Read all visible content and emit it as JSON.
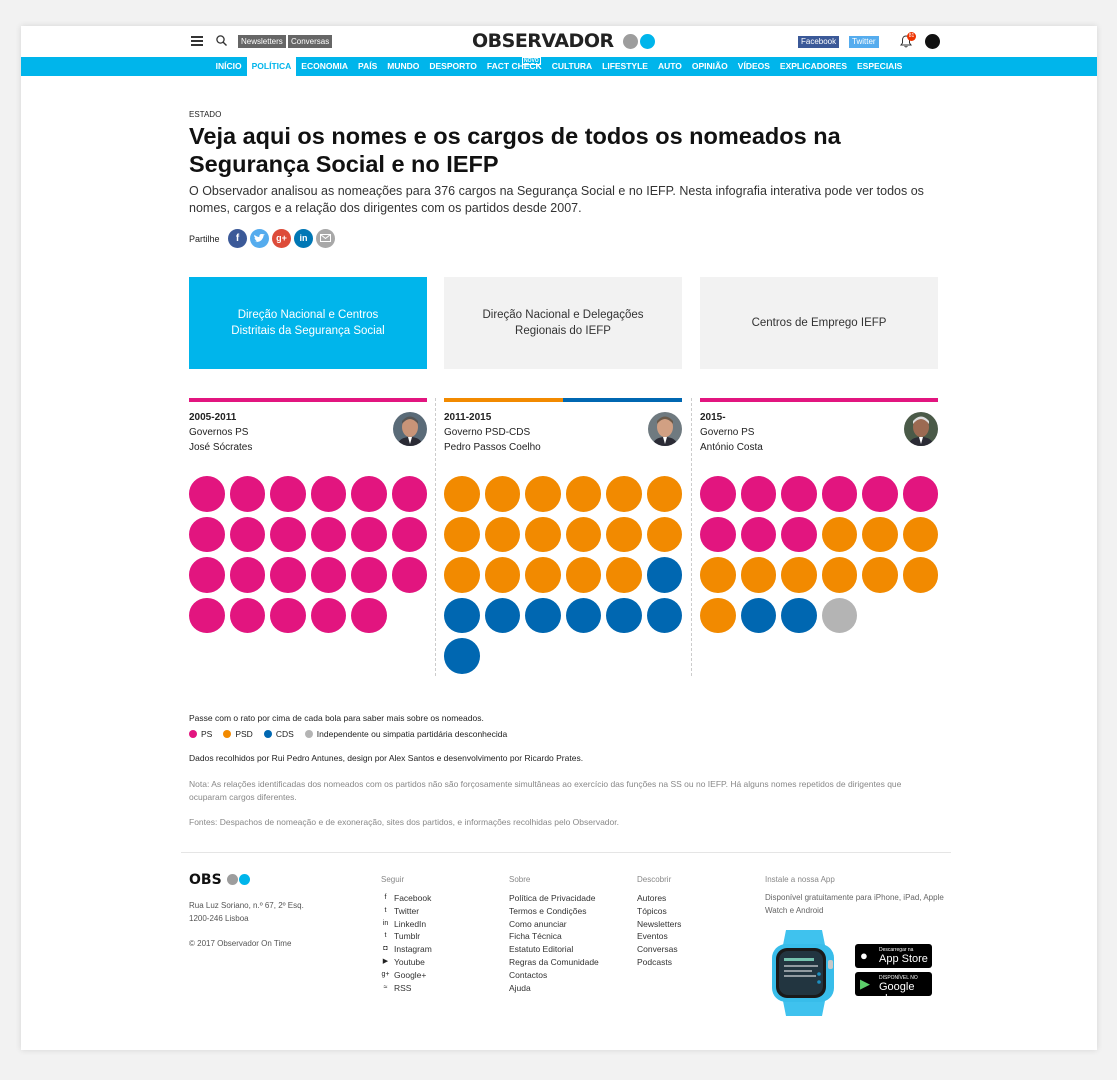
{
  "header": {
    "newsletters": "Newsletters",
    "conversas": "Conversas",
    "logo": "OBSERVADOR",
    "facebook": "Facebook",
    "twitter": "Twitter",
    "notifications": "81"
  },
  "nav": [
    {
      "label": "INÍCIO",
      "active": false
    },
    {
      "label": "POLÍTICA",
      "active": true
    },
    {
      "label": "ECONOMIA",
      "active": false
    },
    {
      "label": "PAÍS",
      "active": false
    },
    {
      "label": "MUNDO",
      "active": false
    },
    {
      "label": "DESPORTO",
      "active": false
    },
    {
      "label": "FACT CHECK",
      "active": false,
      "tag": "NOVO"
    },
    {
      "label": "CULTURA",
      "active": false
    },
    {
      "label": "LIFESTYLE",
      "active": false
    },
    {
      "label": "AUTO",
      "active": false
    },
    {
      "label": "OPINIÃO",
      "active": false
    },
    {
      "label": "VÍDEOS",
      "active": false
    },
    {
      "label": "EXPLICADORES",
      "active": false
    },
    {
      "label": "ESPECIAIS",
      "active": false
    }
  ],
  "article": {
    "kicker": "ESTADO",
    "title": "Veja aqui os nomes e os cargos de todos os nomeados na Segurança Social e no IEFP",
    "lede": "O Observador analisou as nomeações para 376 cargos na Segurança Social e no IEFP. Nesta infografia interativa pode ver todos os nomes, cargos e a relação dos dirigentes com os partidos desde 2007.",
    "share_label": "Partilhe"
  },
  "tabs": [
    {
      "label": "Direção Nacional e Centros Distritais da Segurança Social",
      "active": true
    },
    {
      "label": "Direção Nacional e Delegações Regionais do IEFP",
      "active": false
    },
    {
      "label": "Centros de Emprego IEFP",
      "active": false
    }
  ],
  "colors": {
    "PS": "#e2157f",
    "PSD": "#f28a00",
    "CDS": "#0067b1",
    "IND": "#b4b4b4",
    "accent": "#00b5eb"
  },
  "columns": [
    {
      "years": "2005-2011",
      "gov": "Governos PS",
      "pm": "José Sócrates",
      "bar": [
        "PS"
      ],
      "balls": [
        "PS",
        "PS",
        "PS",
        "PS",
        "PS",
        "PS",
        "PS",
        "PS",
        "PS",
        "PS",
        "PS",
        "PS",
        "PS",
        "PS",
        "PS",
        "PS",
        "PS",
        "PS",
        "PS",
        "PS",
        "PS",
        "PS",
        "PS"
      ]
    },
    {
      "years": "2011-2015",
      "gov": "Governo PSD-CDS",
      "pm": "Pedro Passos Coelho",
      "bar": [
        "PSD",
        "CDS"
      ],
      "balls": [
        "PSD",
        "PSD",
        "PSD",
        "PSD",
        "PSD",
        "PSD",
        "PSD",
        "PSD",
        "PSD",
        "PSD",
        "PSD",
        "PSD",
        "PSD",
        "PSD",
        "PSD",
        "PSD",
        "PSD",
        "CDS",
        "CDS",
        "CDS",
        "CDS",
        "CDS",
        "CDS",
        "CDS",
        "CDS"
      ]
    },
    {
      "years": "2015-",
      "gov": "Governo PS",
      "pm": "António Costa",
      "bar": [
        "PS"
      ],
      "balls": [
        "PS",
        "PS",
        "PS",
        "PS",
        "PS",
        "PS",
        "PS",
        "PS",
        "PS",
        "PSD",
        "PSD",
        "PSD",
        "PSD",
        "PSD",
        "PSD",
        "PSD",
        "PSD",
        "PSD",
        "PSD",
        "CDS",
        "CDS",
        "IND"
      ]
    }
  ],
  "notes": {
    "hover": "Passe com o rato por cima de cada bola para saber mais sobre os nomeados.",
    "legend": [
      {
        "key": "PS",
        "label": "PS"
      },
      {
        "key": "PSD",
        "label": "PSD"
      },
      {
        "key": "CDS",
        "label": "CDS"
      },
      {
        "key": "IND",
        "label": "Independente ou simpatia partidária desconhecida"
      }
    ],
    "credits": "Dados recolhidos por Rui Pedro Antunes, design por Alex Santos e desenvolvimento por Ricardo Prates.",
    "nota": "Nota: As relações identificadas dos nomeados com os partidos não são forçosamente simultâneas ao exercício das funções na SS ou no IEFP. Há alguns nomes repetidos de dirigentes que ocuparam cargos diferentes.",
    "fontes": "Fontes: Despachos de nomeação e de exoneração, sites dos partidos, e informações recolhidas pelo Observador."
  },
  "footer": {
    "logo": "OBS",
    "address1": "Rua Luz Soriano, n.º 67, 2º Esq.",
    "address2": "1200-246 Lisboa",
    "copyright": "© 2017 Observador On Time",
    "seguir_title": "Seguir",
    "seguir": [
      {
        "label": "Facebook",
        "icon": "f"
      },
      {
        "label": "Twitter",
        "icon": "t"
      },
      {
        "label": "LinkedIn",
        "icon": "in"
      },
      {
        "label": "Tumblr",
        "icon": "t"
      },
      {
        "label": "Instagram",
        "icon": "◘"
      },
      {
        "label": "Youtube",
        "icon": "▶"
      },
      {
        "label": "Google+",
        "icon": "g+"
      },
      {
        "label": "RSS",
        "icon": "≈"
      }
    ],
    "sobre_title": "Sobre",
    "sobre": [
      "Política de Privacidade",
      "Termos e Condições",
      "Como anunciar",
      "Ficha Técnica",
      "Estatuto Editorial",
      "Regras da Comunidade",
      "Contactos",
      "Ajuda"
    ],
    "descobrir_title": "Descobrir",
    "descobrir": [
      "Autores",
      "Tópicos",
      "Newsletters",
      "Eventos",
      "Conversas",
      "Podcasts"
    ],
    "app_title": "Instale a nossa App",
    "app_text": "Disponível gratuitamente para iPhone, iPad, Apple Watch e Android",
    "appstore_small": "Descarregar na",
    "appstore_big": "App Store",
    "googleplay_small": "DISPONÍVEL NO",
    "googleplay_big": "Google play"
  }
}
